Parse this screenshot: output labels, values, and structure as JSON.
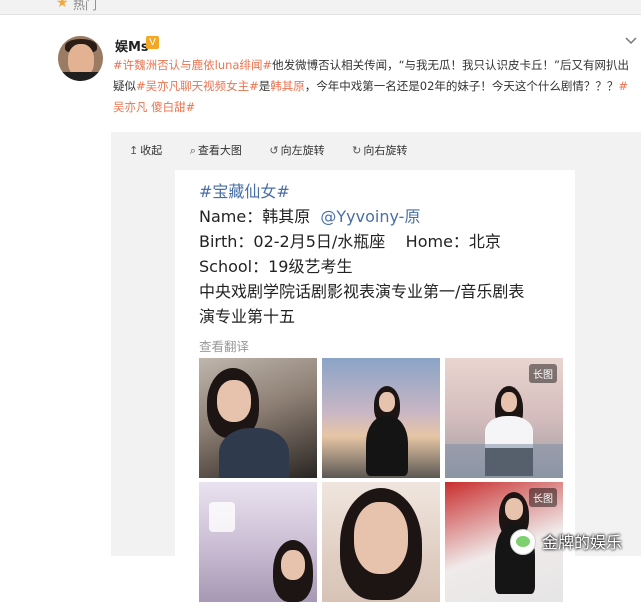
{
  "topbar": {
    "hot_label": "热门"
  },
  "post": {
    "author": "娱Ms",
    "verified": "V",
    "segments": [
      {
        "text": "#许魏洲否认与鹿依luna绯闻#",
        "tag": true
      },
      {
        "text": "他发微博否认相关传闻，“与我无瓜！我只认识皮卡丘！”后又有网扒出疑似",
        "tag": false
      },
      {
        "text": "#吴亦凡聊天视频女主#",
        "tag": true
      },
      {
        "text": "是",
        "tag": false
      },
      {
        "text": "韩其原",
        "tag": true
      },
      {
        "text": "，今年中戏第一名还是02年的妹子！今天这个什么剧情？？？",
        "tag": false
      },
      {
        "text": "#吴亦凡 傻白甜#",
        "tag": true
      }
    ]
  },
  "toolbar": {
    "collapse": "收起",
    "view_large": "查看大图",
    "rotate_left": "向左旋转",
    "rotate_right": "向右旋转"
  },
  "card": {
    "tagline": "#宝藏仙女#",
    "name_label": "Name：韩其原",
    "weibo_handle": "@Yyvoiny-原",
    "birth": "Birth：02-2月5日/水瓶座",
    "home": "Home：北京",
    "school": "School：19级艺考生",
    "desc_line1": "中央戏剧学院话剧影视表演专业第一/音乐剧表",
    "desc_line2": "演专业第十五",
    "translate": "查看翻译",
    "long_image_badge": "长图"
  },
  "watermark": {
    "text": "金牌的娱乐"
  }
}
